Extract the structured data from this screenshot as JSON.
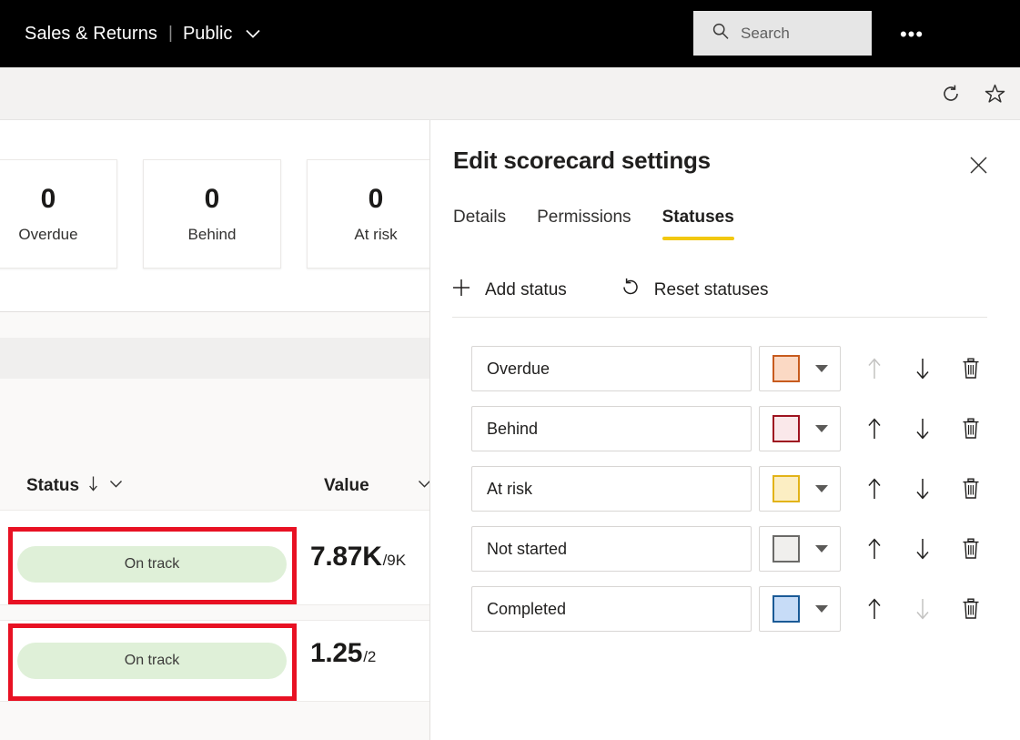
{
  "topbar": {
    "workspace": "Sales & Returns",
    "separator": "|",
    "audience": "Public",
    "chevron_icon": "chevron-down-icon",
    "more_label": "•••",
    "search": {
      "placeholder": "Search",
      "value": "",
      "icon": "search-icon"
    }
  },
  "commandbar": {
    "refresh_icon": "refresh-icon",
    "favorite_icon": "star-icon"
  },
  "scorecard": {
    "cards": [
      {
        "value": "0",
        "label": "Overdue"
      },
      {
        "value": "0",
        "label": "Behind"
      },
      {
        "value": "0",
        "label": "At risk"
      }
    ],
    "table": {
      "columns": [
        {
          "label": "Status",
          "sort_icon": "arrow-down-icon",
          "menu_icon": "chevron-down-icon"
        },
        {
          "label": "Value",
          "sort_icon": "",
          "menu_icon": "chevron-down-icon"
        }
      ],
      "rows": [
        {
          "status": "On track",
          "value_main": "7.87K",
          "value_sub": "/9K",
          "highlighted": true
        },
        {
          "status": "On track",
          "value_main": "1.25",
          "value_sub": "/2",
          "highlighted": true
        }
      ]
    },
    "pill_color": "#dff0d8",
    "highlight_color": "#e81123"
  },
  "panel": {
    "title": "Edit scorecard settings",
    "close_icon": "close-icon",
    "tabs": [
      {
        "label": "Details",
        "active": false
      },
      {
        "label": "Permissions",
        "active": false
      },
      {
        "label": "Statuses",
        "active": true
      }
    ],
    "tab_underline_color": "#f2c811",
    "actions": [
      {
        "label": "Add status",
        "icon": "plus-icon"
      },
      {
        "label": "Reset statuses",
        "icon": "reset-icon"
      }
    ],
    "statuses": [
      {
        "name": "Overdue",
        "fill": "#fbd9c4",
        "stroke": "#c75b1e",
        "up_enabled": false,
        "down_enabled": true
      },
      {
        "name": "Behind",
        "fill": "#fae8ea",
        "stroke": "#9e1420",
        "up_enabled": true,
        "down_enabled": true
      },
      {
        "name": "At risk",
        "fill": "#fceec3",
        "stroke": "#e2b318",
        "up_enabled": true,
        "down_enabled": true
      },
      {
        "name": "Not started",
        "fill": "#f0efed",
        "stroke": "#6b6a68",
        "up_enabled": true,
        "down_enabled": true
      },
      {
        "name": "Completed",
        "fill": "#c7dcf7",
        "stroke": "#1a5a96",
        "up_enabled": true,
        "down_enabled": false
      }
    ],
    "row_icons": {
      "move_up": "arrow-up-icon",
      "move_down": "arrow-down-icon",
      "delete": "trash-icon",
      "color_caret": "caret-down-icon"
    }
  }
}
